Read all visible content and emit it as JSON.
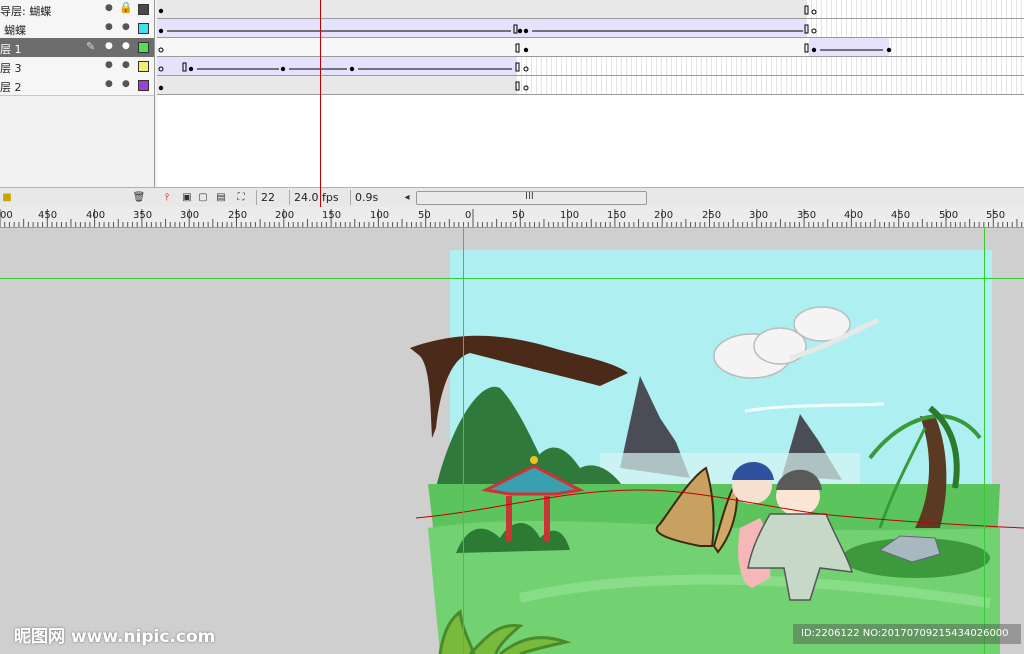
{
  "layers": [
    {
      "name": "导层: 蝴蝶",
      "color": "#4a4a4a",
      "locked": true
    },
    {
      "name": "蝴蝶",
      "color": "#40e0f0",
      "locked": false
    },
    {
      "name": "层 1",
      "color": "#55dd55",
      "locked": false,
      "selected": true
    },
    {
      "name": "层 3",
      "color": "#f0f070",
      "locked": false
    },
    {
      "name": "层 2",
      "color": "#a040d0",
      "locked": false
    }
  ],
  "footer": {
    "current_frame": "22",
    "fps": "24.0 fps",
    "time": "0.9s",
    "scroll_grip": "III"
  },
  "ruler": {
    "labels": [
      "00",
      "450",
      "400",
      "350",
      "300",
      "250",
      "200",
      "150",
      "100",
      "50",
      "0",
      "50",
      "100",
      "150",
      "200",
      "250",
      "300",
      "350",
      "400",
      "450",
      "500",
      "550"
    ]
  },
  "watermark": {
    "logo": "昵图网 www.nipic.com",
    "id_text": "ID:2206122 NO:20170709215434026000"
  },
  "colors": {
    "sky": "#aef0f2",
    "grass": "#5cc45c",
    "guide": "#33cc33",
    "playhead": "#c00000"
  }
}
